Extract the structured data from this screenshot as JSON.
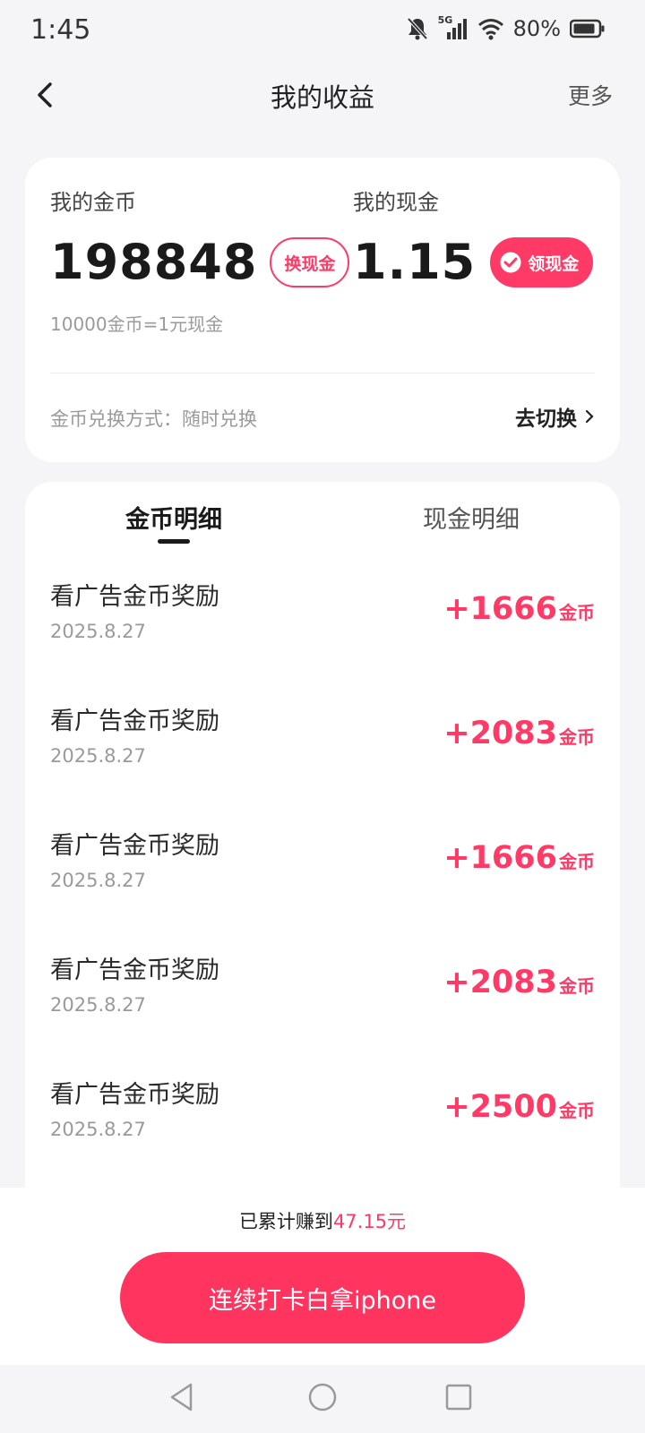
{
  "status": {
    "time": "1:45",
    "network": "5G",
    "battery": "80%"
  },
  "nav": {
    "title": "我的收益",
    "more": "更多"
  },
  "summary": {
    "coin_label": "我的金币",
    "coin_value": "198848",
    "coin_button": "换现金",
    "cash_label": "我的现金",
    "cash_value": "1.15",
    "cash_button": "领现金",
    "rate": "10000金币=1元现金",
    "mode_text": "金币兑换方式：随时兑换",
    "mode_switch": "去切换"
  },
  "tabs": [
    {
      "label": "金币明细",
      "active": true
    },
    {
      "label": "现金明细",
      "active": false
    }
  ],
  "records": [
    {
      "title": "看广告金币奖励",
      "date": "2025.8.27",
      "amount": "+1666",
      "unit": "金币"
    },
    {
      "title": "看广告金币奖励",
      "date": "2025.8.27",
      "amount": "+2083",
      "unit": "金币"
    },
    {
      "title": "看广告金币奖励",
      "date": "2025.8.27",
      "amount": "+1666",
      "unit": "金币"
    },
    {
      "title": "看广告金币奖励",
      "date": "2025.8.27",
      "amount": "+2083",
      "unit": "金币"
    },
    {
      "title": "看广告金币奖励",
      "date": "2025.8.27",
      "amount": "+2500",
      "unit": "金币"
    }
  ],
  "footer": {
    "earn_prefix": "已累计赚到",
    "earn_amount": "47.15元",
    "cta": "连续打卡白拿iphone"
  },
  "colors": {
    "accent": "#ff3a66",
    "background": "#f5f5f7"
  }
}
